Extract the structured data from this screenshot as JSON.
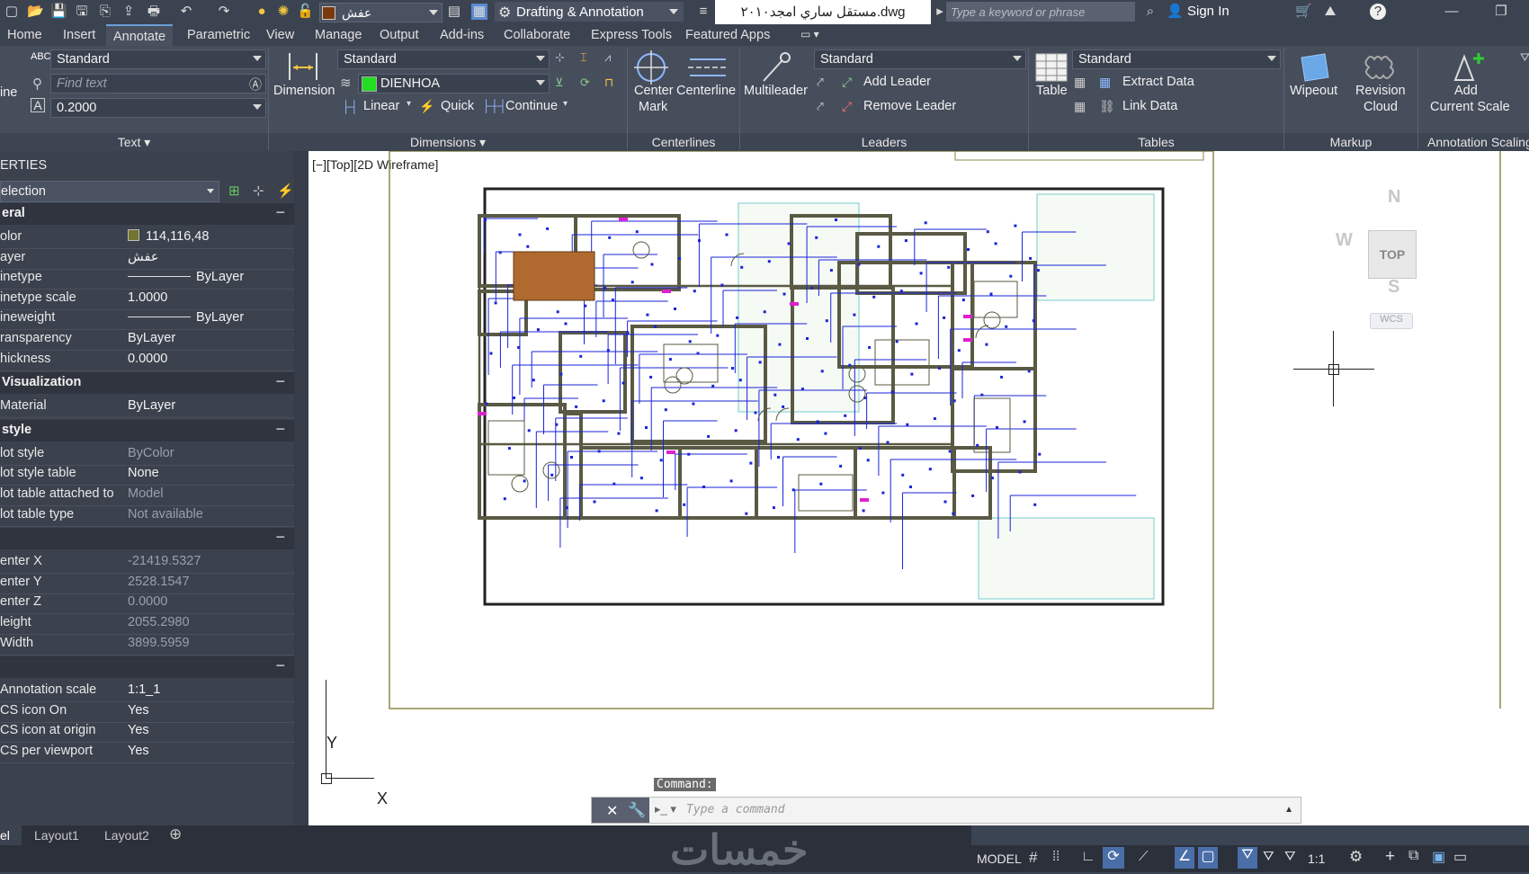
{
  "title_bar": {
    "layer_name": "عفش",
    "workspace": "Drafting & Annotation",
    "document_title": "مستقل ساري امجد٢٠١٠.dwg",
    "search_placeholder": "Type a keyword or phrase",
    "sign_in": "Sign In"
  },
  "menu_tabs": [
    "Home",
    "Insert",
    "Annotate",
    "Parametric",
    "View",
    "Manage",
    "Output",
    "Add-ins",
    "Collaborate",
    "Express Tools",
    "Featured Apps"
  ],
  "ribbon": {
    "text_panel": {
      "style": "Standard",
      "find_placeholder": "Find text",
      "height": "0.2000",
      "multiline_label": "ine",
      "title": "Text"
    },
    "dimensions_panel": {
      "dimension_label": "Dimension",
      "style": "Standard",
      "layer": "DIENHOA",
      "linear": "Linear",
      "quick": "Quick",
      "continue": "Continue",
      "title": "Dimensions"
    },
    "centerlines_panel": {
      "center_mark_1": "Center",
      "center_mark_2": "Mark",
      "centerline": "Centerline",
      "title": "Centerlines"
    },
    "leaders_panel": {
      "multileader": "Multileader",
      "style": "Standard",
      "add_leader": "Add Leader",
      "remove_leader": "Remove Leader",
      "title": "Leaders"
    },
    "tables_panel": {
      "table": "Table",
      "style": "Standard",
      "extract_data": "Extract Data",
      "link_data": "Link Data",
      "title": "Tables"
    },
    "markup_panel": {
      "wipeout": "Wipeout",
      "revision_1": "Revision",
      "revision_2": "Cloud",
      "title": "Markup"
    },
    "annotation_scaling_panel": {
      "add_1": "Add",
      "add_2": "Current Scale",
      "title": "Annotation Scaling"
    }
  },
  "properties": {
    "header": "ERTIES",
    "selection": "election",
    "sections": [
      {
        "title": "eral",
        "rows": [
          {
            "k": "olor",
            "v": "114,116,48",
            "swatch": "#727430"
          },
          {
            "k": "ayer",
            "v": "عفش"
          },
          {
            "k": "inetype",
            "v": "ByLayer",
            "line": true
          },
          {
            "k": "inetype scale",
            "v": "1.0000"
          },
          {
            "k": "ineweight",
            "v": "ByLayer",
            "line": true
          },
          {
            "k": "ransparency",
            "v": "ByLayer"
          },
          {
            "k": "hickness",
            "v": "0.0000"
          }
        ]
      },
      {
        "title": "Visualization",
        "rows": [
          {
            "k": "Material",
            "v": "ByLayer"
          }
        ]
      },
      {
        "title": "style",
        "rows": [
          {
            "k": "lot style",
            "v": "ByColor",
            "dim": true
          },
          {
            "k": "lot style table",
            "v": "None"
          },
          {
            "k": "lot table attached to",
            "v": "Model",
            "dim": true
          },
          {
            "k": "lot table type",
            "v": "Not available",
            "dim": true
          }
        ]
      },
      {
        "title": "",
        "rows": [
          {
            "k": "enter X",
            "v": "-21419.5327",
            "dim": true
          },
          {
            "k": "enter Y",
            "v": "2528.1547",
            "dim": true
          },
          {
            "k": "enter Z",
            "v": "0.0000",
            "dim": true
          },
          {
            "k": "leight",
            "v": "2055.2980",
            "dim": true
          },
          {
            "k": "Width",
            "v": "3899.5959",
            "dim": true
          }
        ]
      },
      {
        "title": "",
        "rows": [
          {
            "k": "Annotation scale",
            "v": "1:1_1"
          },
          {
            "k": "CS icon On",
            "v": "Yes"
          },
          {
            "k": "CS icon at origin",
            "v": "Yes"
          },
          {
            "k": "CS per viewport",
            "v": "Yes"
          }
        ]
      }
    ]
  },
  "viewport": {
    "label": "[−][Top][2D Wireframe]",
    "viewcube_top": "TOP",
    "compass_n": "N",
    "compass_s": "S",
    "compass_w": "W",
    "wcs": "WCS",
    "ucs_x": "X",
    "ucs_y": "Y"
  },
  "command": {
    "label": "Command:",
    "placeholder": "Type a command"
  },
  "layout_tabs": [
    "el",
    "Layout1",
    "Layout2"
  ],
  "status": {
    "model": "MODEL",
    "scale": "1:1"
  },
  "watermark": "خمسات"
}
